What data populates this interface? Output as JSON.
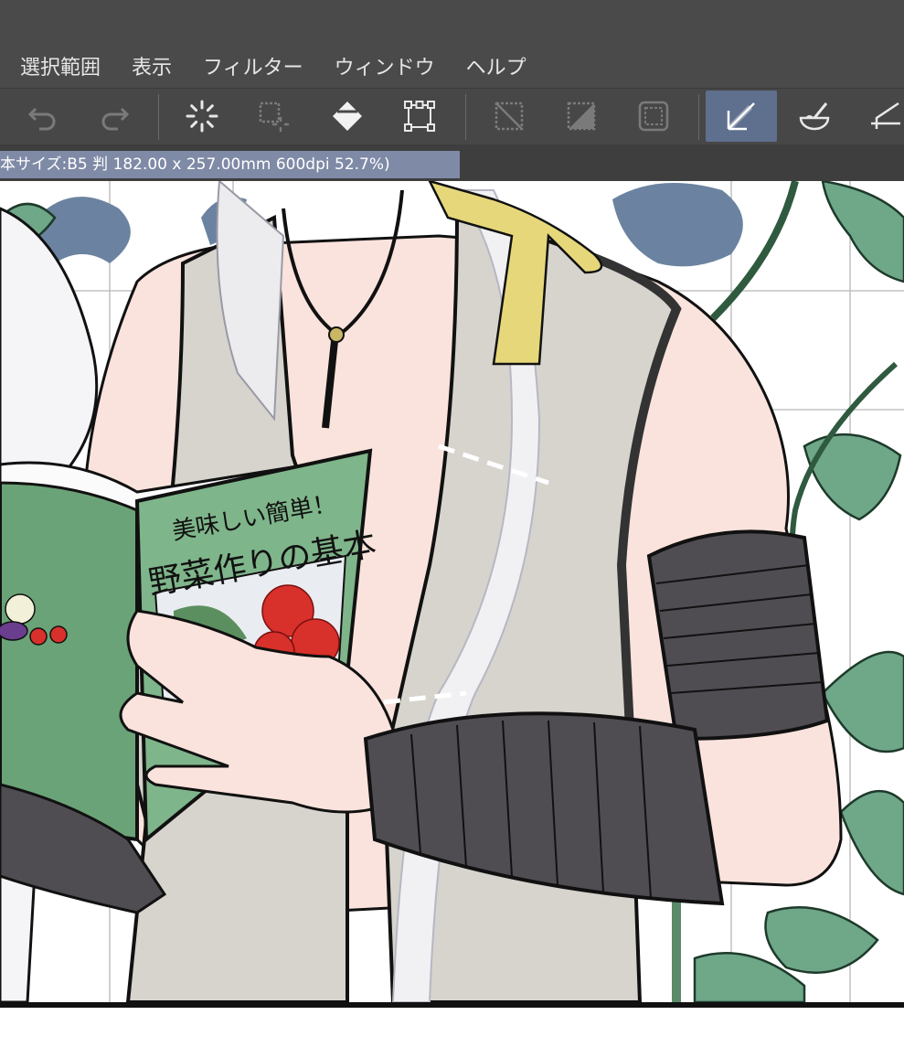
{
  "menu": [
    {
      "label": "選択範囲"
    },
    {
      "label": "表示"
    },
    {
      "label": "フィルター"
    },
    {
      "label": "ウィンドウ"
    },
    {
      "label": "ヘルプ"
    }
  ],
  "toolbar": {
    "tools": [
      {
        "icon": "undo-icon"
      },
      {
        "icon": "redo-icon"
      },
      {
        "icon": "loading-spinner-icon"
      },
      {
        "icon": "selection-spinner-icon"
      },
      {
        "icon": "fill-bucket-icon"
      },
      {
        "icon": "transform-icon"
      },
      {
        "icon": "deselect-icon"
      },
      {
        "icon": "invert-selection-icon"
      },
      {
        "icon": "selection-border-icon"
      },
      {
        "icon": "ruler-snap-icon",
        "active": true
      },
      {
        "icon": "brush-bowl-icon"
      },
      {
        "icon": "ruler-icon"
      }
    ],
    "active_color": "#5f6f8e"
  },
  "status": {
    "doc_info": "本サイズ:B5 判 182.00 x 257.00mm 600dpi 52.7%)"
  },
  "canvas": {
    "book_title_small": "美味しい簡単！",
    "book_title_large": "野菜作りの基本"
  }
}
